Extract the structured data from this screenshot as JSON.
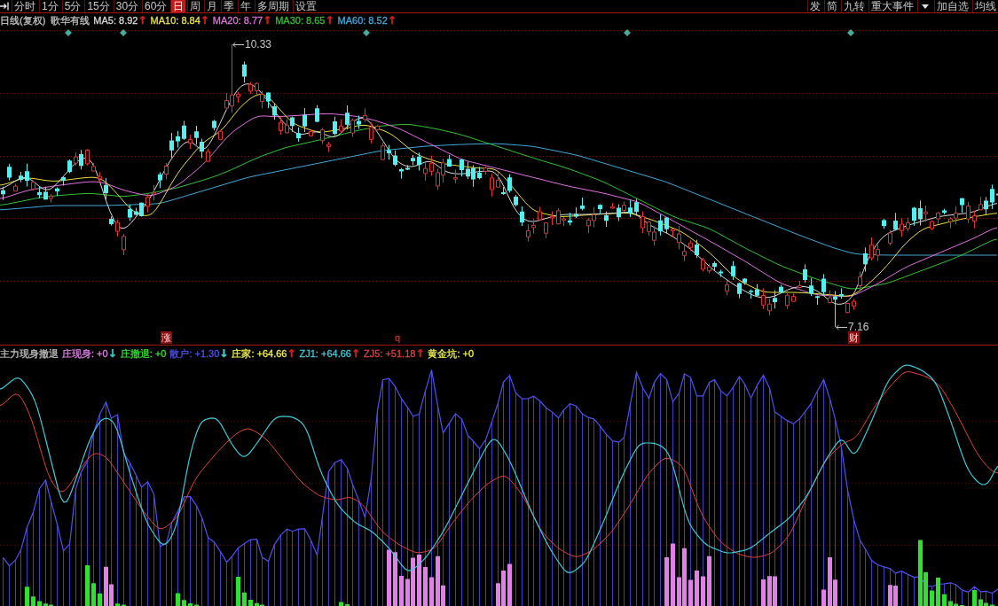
{
  "toolbar": {
    "tabs": [
      {
        "label": "分时",
        "selected": false
      },
      {
        "label": "1分",
        "selected": false
      },
      {
        "label": "5分",
        "selected": false
      },
      {
        "label": "15分",
        "selected": false
      },
      {
        "label": "30分",
        "selected": false
      },
      {
        "label": "60分",
        "selected": false
      },
      {
        "label": "日",
        "selected": true
      },
      {
        "label": "周",
        "selected": false
      },
      {
        "label": "月",
        "selected": false
      },
      {
        "label": "季",
        "selected": false
      },
      {
        "label": "年",
        "selected": false
      },
      {
        "label": "多周期",
        "selected": false
      },
      {
        "label": "设置",
        "selected": false
      }
    ],
    "right_buttons": [
      {
        "kind": "text",
        "label": "发"
      },
      {
        "kind": "text",
        "label": "简"
      },
      {
        "kind": "text",
        "label": "九转"
      },
      {
        "kind": "text",
        "label": "重大事件"
      },
      {
        "kind": "dropdown"
      },
      {
        "kind": "text",
        "label": "加自选"
      },
      {
        "kind": "text",
        "label": "均线"
      }
    ]
  },
  "price_chart": {
    "period": "日线(复权)",
    "stock_name": "歌华有线",
    "moving_averages": [
      {
        "text": "MA5: 8.92",
        "color": "#d8d8d8",
        "arrow": {
          "text": "↑",
          "color": "#c82020"
        }
      },
      {
        "text": "MA10: 8.84",
        "color": "#e8e040",
        "arrow": {
          "text": "↑",
          "color": "#c82020"
        }
      },
      {
        "text": "MA20: 8.77",
        "color": "#e070e0",
        "arrow": {
          "text": "↑",
          "color": "#c82020"
        }
      },
      {
        "text": "MA30: 8.65",
        "color": "#30c030",
        "arrow": {
          "text": "↑",
          "color": "#c82020"
        }
      },
      {
        "text": "MA60: 8.52",
        "color": "#40a8d8",
        "arrow": {
          "text": "↑",
          "color": "#c82020"
        }
      }
    ],
    "high_label": "10.33",
    "low_label": "7.16",
    "event_markers": [
      {
        "kind": "tag",
        "label": "涨"
      },
      {
        "kind": "letter",
        "label": "q"
      },
      {
        "kind": "tag",
        "label": "财"
      }
    ]
  },
  "indicator": {
    "name": "主力现身撤退",
    "values": [
      {
        "text": "庄现身: +0",
        "color": "#e080e8",
        "arrow": {
          "text": "↓",
          "color": "#40c0c0"
        }
      },
      {
        "text": "庄撤退: +0",
        "color": "#30e030"
      },
      {
        "text": "散户: +1.30",
        "color": "#5050f0",
        "arrow": {
          "text": "↓",
          "color": "#40c0c0"
        }
      },
      {
        "text": "庄家: +64.66",
        "color": "#f0f050",
        "arrow": {
          "text": "↑",
          "color": "#c82020"
        }
      },
      {
        "text": "ZJ1: +64.66",
        "color": "#40c8d8",
        "arrow": {
          "text": "↑",
          "color": "#c82020"
        }
      },
      {
        "text": "ZJ5: +51.18",
        "color": "#e04040",
        "arrow": {
          "text": "↑",
          "color": "#c82020"
        }
      },
      {
        "text": "黄金坑: +0",
        "color": "#f0f050"
      }
    ]
  }
}
